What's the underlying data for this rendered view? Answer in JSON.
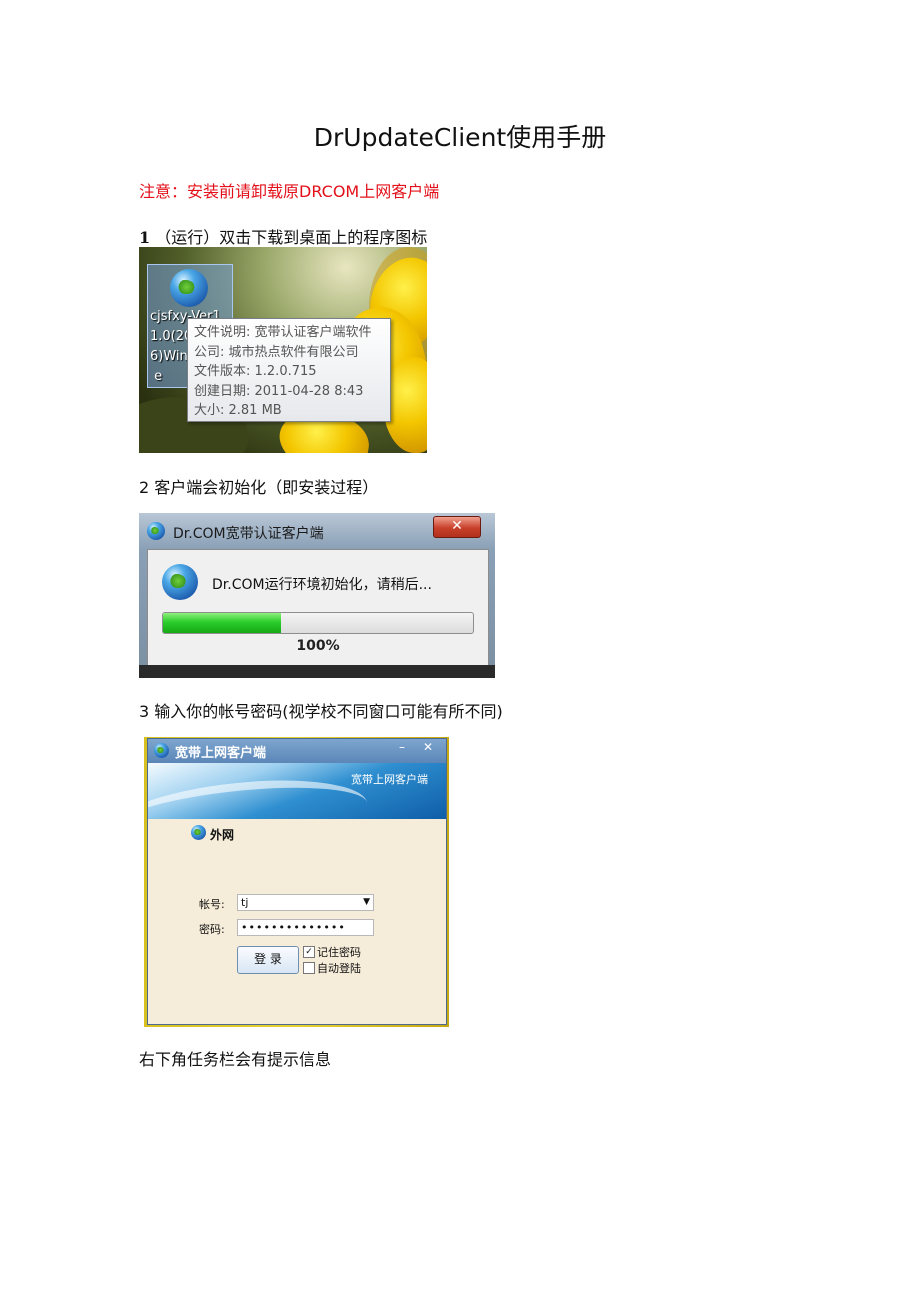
{
  "doc": {
    "title": "DrUpdateClient使用手册",
    "warning": "注意：安装前请卸载原DRCOM上网客户端",
    "step1_num": "1",
    "step1_text": "（运行）双击下载到桌面上的程序图标",
    "step2": "2 客户端会初始化（即安装过程）",
    "step3": "3 输入你的帐号密码(视学校不同窗口可能有所不同)",
    "footer_note": "右下角任务栏会有提示信息"
  },
  "shot1": {
    "icon_label": "cjsfxy-Ver1\n1.0(20\n6)Win\n e",
    "tooltip": [
      "文件说明: 宽带认证客户端软件",
      "公司: 城市热点软件有限公司",
      "文件版本: 1.2.0.715",
      "创建日期: 2011-04-28 8:43",
      "大小: 2.81 MB"
    ]
  },
  "shot2": {
    "window_title": "Dr.COM宽带认证客户端",
    "close": "✕",
    "message": "Dr.COM运行环境初始化，请稍后...",
    "progress_fraction": 1.0,
    "progress_fill_fraction": 0.38,
    "progress_text": "100%"
  },
  "shot3": {
    "window_title": "宽带上网客户端",
    "minimize": "–",
    "close": "✕",
    "banner_text": "宽带上网客户端",
    "network": "外网",
    "account_label": "帐号:",
    "account_value": "tj",
    "password_label": "密码:",
    "password_value": "••••••••••••••",
    "login_button": "登 录",
    "remember_label": "记住密码",
    "auto_label": "自动登陆"
  }
}
